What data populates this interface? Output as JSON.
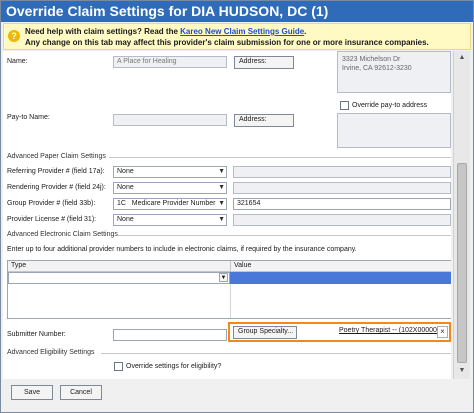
{
  "window": {
    "title": "Override Claim Settings for DIA HUDSON, DC (1)"
  },
  "infobar": {
    "icon": "question-icon",
    "line1_prefix": "Need help with claim settings? Read the ",
    "line1_link": "Kareo New Claim Settings Guide",
    "line1_suffix": ".",
    "line2": "Any change on this tab may affect this provider's claim submission for one or more insurance companies."
  },
  "name_row": {
    "label": "Name:",
    "value": "A Place for Healing",
    "address_button": "Address:",
    "address_lines": [
      "3323 Michelson Dr",
      "Irvine, CA 92612-3230"
    ]
  },
  "payto_row": {
    "label": "Pay-to Name:",
    "value": "",
    "address_button": "Address:",
    "override_label": "Override pay-to address",
    "override_checked": false
  },
  "paper_section": {
    "header": "Advanced Paper Claim Settings",
    "referring": {
      "label": "Referring Provider # (field 17a):",
      "value": "None"
    },
    "rendering": {
      "label": "Rendering Provider # (field 24j):",
      "value": "None"
    },
    "group": {
      "label": "Group Provider # (field 33b):",
      "qualifier": "1C",
      "type": "Medicare Provider Number",
      "number": "321654"
    },
    "license": {
      "label": "Provider License # (field 31):",
      "value": "None"
    }
  },
  "electronic_section": {
    "header": "Advanced Electronic Claim Settings",
    "instructions": "Enter up to four additional provider numbers to include in electronic claims, if required by the insurance company.",
    "grid": {
      "columns": [
        "Type",
        "Value"
      ],
      "rows": [
        {
          "type": "",
          "value": ""
        }
      ]
    },
    "submitter_label": "Submitter Number:",
    "submitter_value": "",
    "group_specialty_button": "Group Specialty...",
    "group_specialty_value": "Poetry Therapist -- (102X00000X)",
    "clear_icon": "close-icon"
  },
  "eligibility_section": {
    "header": "Advanced Eligibility Settings",
    "override_label": "Override settings for eligibility?",
    "override_checked": false
  },
  "footer": {
    "save_label": "Save",
    "cancel_label": "Cancel"
  },
  "colors": {
    "title_bar": "#2f6bb8",
    "infobar_bg": "#fff9c4",
    "highlight_border": "#f08a1c",
    "selection": "#4a78d8",
    "link": "#1a4fcf"
  }
}
